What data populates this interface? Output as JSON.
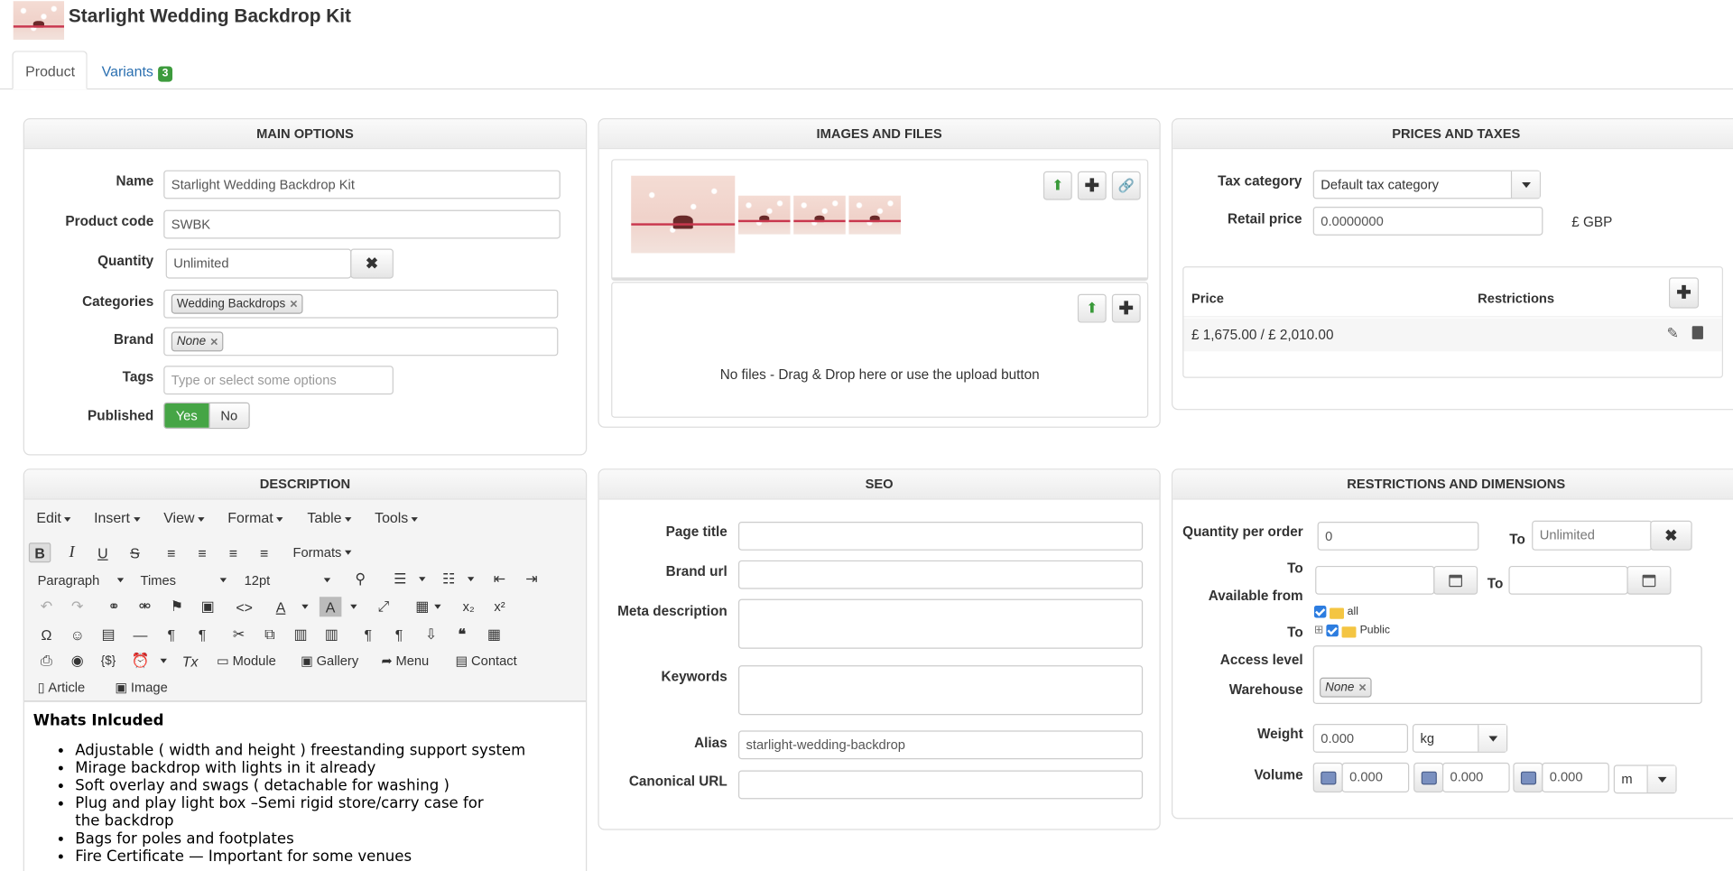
{
  "header": {
    "title": "Starlight Wedding Backdrop Kit"
  },
  "tabs": [
    {
      "label": "Product"
    },
    {
      "label": "Variants",
      "badge": "3"
    }
  ],
  "main_options": {
    "heading": "MAIN OPTIONS",
    "name_label": "Name",
    "name_value": "Starlight Wedding Backdrop Kit",
    "code_label": "Product code",
    "code_value": "SWBK",
    "qty_label": "Quantity",
    "qty_value": "Unlimited",
    "categories_label": "Categories",
    "category_tag": "Wedding Backdrops",
    "brand_label": "Brand",
    "brand_tag": "None",
    "tags_label": "Tags",
    "tags_placeholder": "Type or select some options",
    "published_label": "Published",
    "yes": "Yes",
    "no": "No"
  },
  "images": {
    "heading": "IMAGES AND FILES",
    "no_files": "No files - Drag & Drop here or use the upload button"
  },
  "prices": {
    "heading": "PRICES AND TAXES",
    "tax_label": "Tax category",
    "tax_value": "Default tax category",
    "retail_label": "Retail price",
    "retail_value": "0.0000000",
    "currency": "£ GBP",
    "col_price": "Price",
    "col_restrictions": "Restrictions",
    "row_price": "£ 1,675.00 / £ 2,010.00"
  },
  "description": {
    "heading": "DESCRIPTION",
    "menus": [
      "Edit",
      "Insert",
      "View",
      "Format",
      "Table",
      "Tools"
    ],
    "formats": "Formats",
    "paragraph": "Paragraph",
    "font": "Times",
    "size": "12pt",
    "btn_module": "Module",
    "btn_gallery": "Gallery",
    "btn_menu": "Menu",
    "btn_contact": "Contact",
    "btn_article": "Article",
    "btn_image": "Image",
    "content_heading": "Whats Inlcuded",
    "items": [
      "Adjustable ( width and height ) freestanding support system",
      "Mirage backdrop with lights in it already",
      "Soft overlay and swags ( detachable for washing )",
      "Plug and play light box –Semi rigid store/carry case for the backdrop",
      "Bags for poles and footplates",
      "Fire Certificate — Important for some venues"
    ]
  },
  "seo": {
    "heading": "SEO",
    "page_title_label": "Page title",
    "brand_url_label": "Brand url",
    "meta_label": "Meta description",
    "keywords_label": "Keywords",
    "alias_label": "Alias",
    "alias_value": "starlight-wedding-backdrop",
    "canonical_label": "Canonical URL"
  },
  "restrictions": {
    "heading": "RESTRICTIONS AND DIMENSIONS",
    "qpo_label": "Quantity per order",
    "qpo_value": "0",
    "to_label": "To",
    "to_value": "Unlimited",
    "available_label": "Available from",
    "tree_all": "all",
    "tree_public": "Public",
    "access_label": "Access level",
    "warehouse_label": "Warehouse",
    "warehouse_tag": "None",
    "weight_label": "Weight",
    "weight_value": "0.000",
    "weight_unit": "kg",
    "volume_label": "Volume",
    "vol1": "0.000",
    "vol2": "0.000",
    "vol3": "0.000",
    "vol_unit": "m"
  }
}
